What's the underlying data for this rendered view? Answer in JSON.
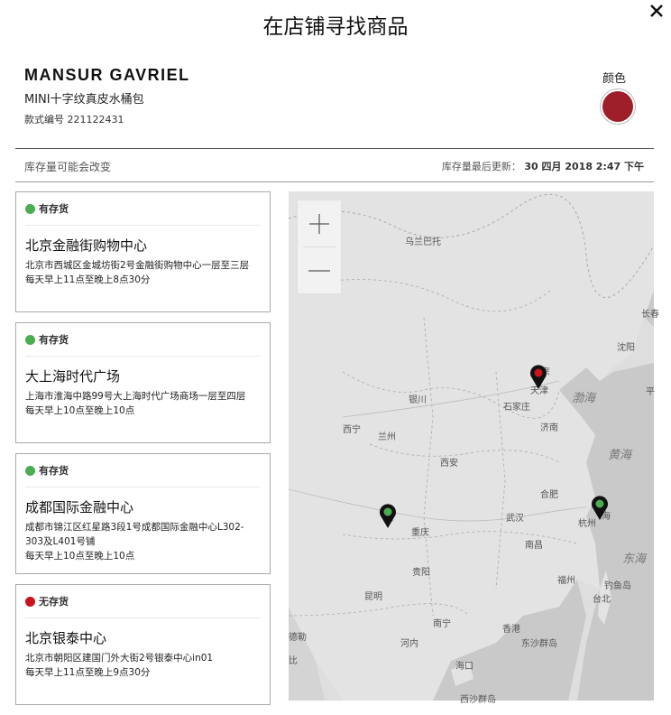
{
  "modal": {
    "title": "在店铺寻找商品"
  },
  "product": {
    "brand": "MANSUR GAVRIEL",
    "name": "MINI十字纹真皮水桶包",
    "style_code": "款式编号 221122431",
    "color_label": "颜色",
    "color_hex": "#9e1f2a"
  },
  "stock": {
    "note": "库存量可能会改变",
    "updated_label": "库存量最后更新：",
    "updated_value": "30 四月 2018 2:47 下午"
  },
  "stores": [
    {
      "status": "有存货",
      "status_color": "#4aad52",
      "name": "北京金融街购物中心",
      "address": "北京市西城区金城坊街2号金融街购物中心一层至三层",
      "hours": "每天早上11点至晚上8点30分"
    },
    {
      "status": "有存货",
      "status_color": "#4aad52",
      "name": "大上海时代广场",
      "address": "上海市淮海中路99号大上海时代广场商场一层至四层",
      "hours": "每天早上10点至晚上10点"
    },
    {
      "status": "有存货",
      "status_color": "#4aad52",
      "name": "成都国际金融中心",
      "address": "成都市锦江区红星路3段1号成都国际金融中心L302-303及L401号铺",
      "hours": "每天早上10点至晚上10点"
    },
    {
      "status": "无存货",
      "status_color": "#c8151d",
      "name": "北京银泰中心",
      "address": "北京市朝阳区建国门外大街2号银泰中心in01",
      "hours": "每天早上11点至晚上9点30分"
    }
  ],
  "map": {
    "labels": [
      "乌兰巴托",
      "长春",
      "沈阳",
      "北京",
      "天津",
      "渤海",
      "平",
      "银川",
      "石家庄",
      "西宁",
      "兰州",
      "济南",
      "黄海",
      "西安",
      "合肥",
      "都",
      "重庆",
      "武汉",
      "杭州",
      "海",
      "东海",
      "南昌",
      "贵阳",
      "福州",
      "钓鱼岛",
      "台北",
      "昆明",
      "南宁",
      "香港",
      "德勒",
      "河内",
      "东沙群岛",
      "比",
      "海口",
      "西沙群岛"
    ],
    "pins": [
      {
        "name": "beijing",
        "color": "#c8151d"
      },
      {
        "name": "chengdu",
        "color": "#4aad52"
      },
      {
        "name": "shanghai",
        "color": "#4aad52"
      }
    ]
  },
  "icons": {
    "close": "close-icon",
    "zoom_in": "plus-icon",
    "zoom_out": "minus-icon",
    "pin": "map-pin-icon"
  }
}
